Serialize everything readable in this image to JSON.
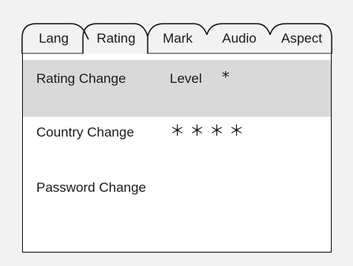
{
  "tabs": [
    {
      "label": "Lang",
      "active": false
    },
    {
      "label": "Rating",
      "active": true
    },
    {
      "label": "Mark",
      "active": false
    },
    {
      "label": "Audio",
      "active": false
    },
    {
      "label": "Aspect",
      "active": false
    }
  ],
  "settings": [
    {
      "label": "Rating Change",
      "value_label": "Level",
      "value": "*",
      "selected": true
    },
    {
      "label": "Country Change",
      "value": "＊＊＊＊",
      "selected": false
    },
    {
      "label": "Password Change",
      "value": "",
      "selected": false
    }
  ],
  "colors": {
    "background": "#f2f2f2",
    "panel": "#ffffff",
    "selected_row": "#d9d9d9",
    "border": "#111111"
  }
}
